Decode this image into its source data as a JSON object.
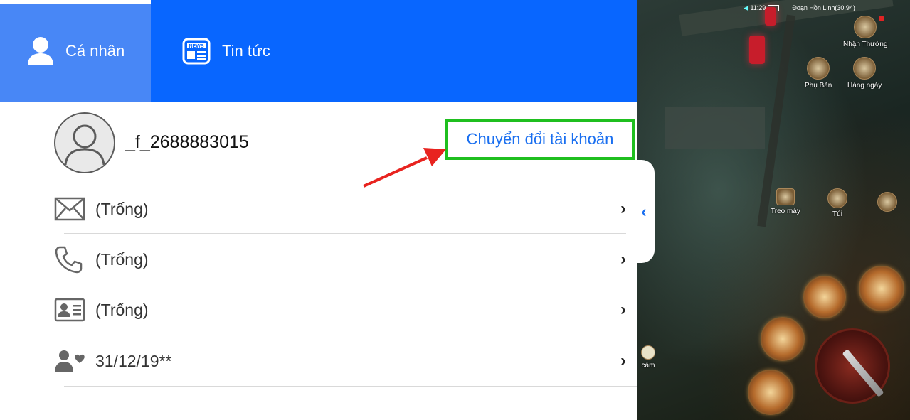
{
  "tabs": [
    {
      "label": "Cá nhân",
      "icon": "user-icon",
      "active": true
    },
    {
      "label": "Tin tức",
      "icon": "news-icon",
      "active": false
    }
  ],
  "profile": {
    "username": "_f_2688883015",
    "switch_account_label": "Chuyển đổi tài khoản"
  },
  "info_rows": [
    {
      "icon": "mail-icon",
      "value": "(Trống)"
    },
    {
      "icon": "phone-icon",
      "value": "(Trống)"
    },
    {
      "icon": "id-card-icon",
      "value": "(Trống)"
    },
    {
      "icon": "user-heart-icon",
      "value": "31/12/19**"
    }
  ],
  "game_hud": {
    "clock": "11:29",
    "player": "Đoạn Hồn Linh(30,94)",
    "rewards": "Nhận Thưởng",
    "dungeon": "Phụ Bản",
    "daily": "Hàng ngày",
    "afk": "Treo máy",
    "bag": "Túi",
    "emote": "cảm"
  },
  "colors": {
    "tab_bar": "#0866ff",
    "tab_active": "#4887f6",
    "link": "#1a6ff0",
    "highlight_box": "#1fbf1f",
    "annotation_arrow": "#e8231f"
  }
}
